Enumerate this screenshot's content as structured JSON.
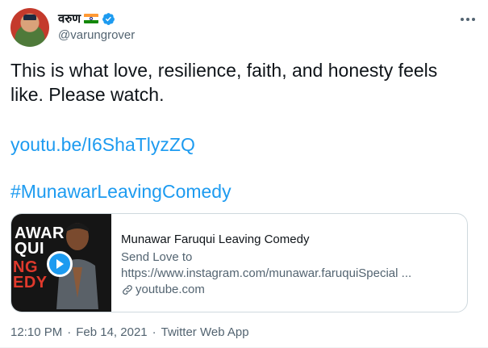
{
  "author": {
    "display_name": "वरुण",
    "handle": "@varungrover",
    "flag_icon": "india-flag-icon",
    "verified_icon": "verified-badge-icon"
  },
  "tweet": {
    "text_line1": "This is what love, resilience, faith, and honesty feels",
    "text_line2": "like. Please watch.",
    "link": "youtu.be/I6ShaTlyzZQ",
    "hashtag": "#MunawarLeavingComedy"
  },
  "card": {
    "thumb_text_1": "AWAR",
    "thumb_text_2": "QUI",
    "thumb_text_3": "NG",
    "thumb_text_4": "EDY",
    "title": "Munawar Faruqui Leaving Comedy",
    "description_line1": "Send Love to",
    "description_line2": "https://www.instagram.com/munawar.faruquiSpecial ...",
    "domain": "youtube.com"
  },
  "meta": {
    "time": "12:10 PM",
    "separator": "·",
    "date": "Feb 14, 2021",
    "source": "Twitter Web App"
  },
  "colors": {
    "link": "#1d9bf0",
    "secondary_text": "#536471",
    "thumb_red": "#e0392c"
  }
}
